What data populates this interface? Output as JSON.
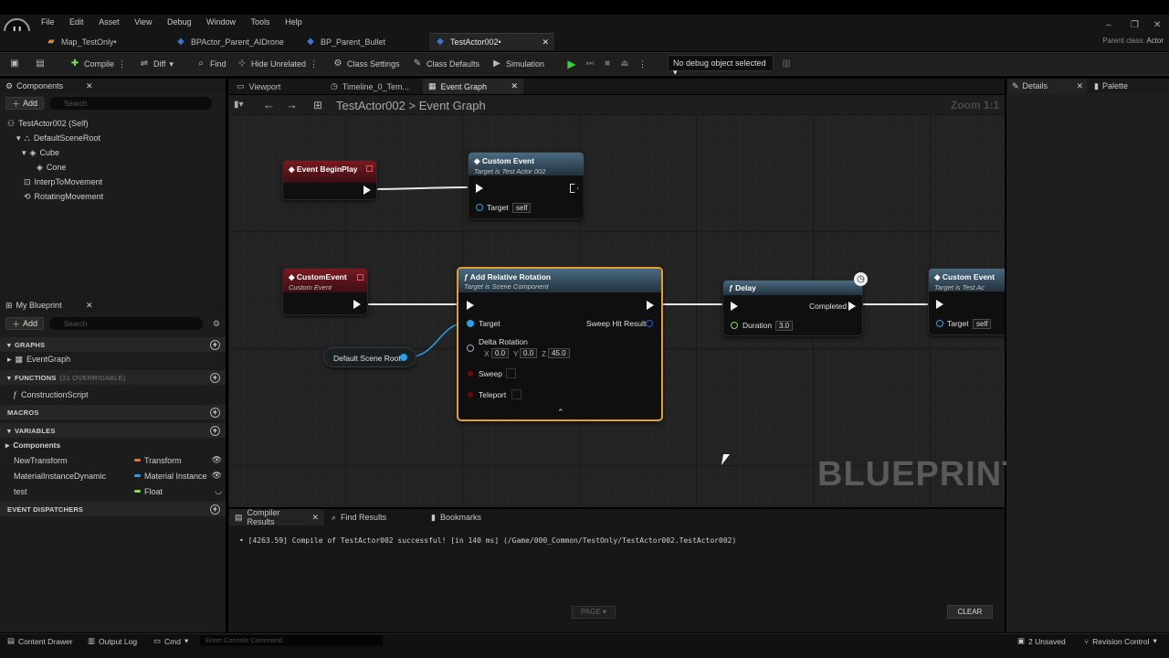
{
  "menu": [
    "File",
    "Edit",
    "Asset",
    "View",
    "Debug",
    "Window",
    "Tools",
    "Help"
  ],
  "logo_icon": "unreal-logo-icon",
  "doc_tabs": [
    {
      "label": "Map_TestOnly•",
      "icon": "map-icon"
    },
    {
      "label": "BPActor_Parent_AIDrone",
      "icon": "blueprint-icon"
    },
    {
      "label": "BP_Parent_Bullet",
      "icon": "blueprint-icon"
    },
    {
      "label": "TestActor002•",
      "icon": "blueprint-icon",
      "active": true
    }
  ],
  "parent_class": {
    "label": "Parent class:",
    "value": "Actor"
  },
  "toolbar": {
    "compile": "Compile",
    "diff": "Diff",
    "find": "Find",
    "hide_unrelated": "Hide Unrelated",
    "class_settings": "Class Settings",
    "class_defaults": "Class Defaults",
    "simulation": "Simulation",
    "debug_object": "No debug object selected"
  },
  "components": {
    "title": "Components",
    "add": "Add",
    "search_placeholder": "Search",
    "tree": [
      "TestActor002 (Self)",
      "DefaultSceneRoot",
      "Cube",
      "Cone",
      "InterpToMovement",
      "RotatingMovement"
    ]
  },
  "my_blueprint": {
    "title": "My Blueprint",
    "add": "Add",
    "search_placeholder": "Search",
    "graphs_label": "GRAPHS",
    "event_graph": "EventGraph",
    "functions_label": "FUNCTIONS",
    "functions_count": "(21 OVERRIDABLE)",
    "construction_script": "ConstructionScript",
    "macros_label": "MACROS",
    "variables_label": "VARIABLES",
    "components_group": "Components",
    "variables": [
      {
        "name": "NewTransform",
        "type": "Transform",
        "color": "#e8743a"
      },
      {
        "name": "MaterialInstanceDynamic",
        "type": "Material Instance",
        "color": "#27a0e8"
      },
      {
        "name": "test",
        "type": "Float",
        "color": "#7ee04a"
      }
    ],
    "dispatchers_label": "EVENT DISPATCHERS"
  },
  "graph_tabs": [
    "Viewport",
    "Timeline_0_Tem...",
    "Event Graph"
  ],
  "breadcrumb": {
    "root": "TestActor002",
    "sep": ">",
    "current": "Event Graph"
  },
  "zoom": "Zoom 1:1",
  "watermark": "BLUEPRINT",
  "nodes": {
    "begin_play": {
      "title": "Event BeginPlay"
    },
    "custom_event_call_1": {
      "title": "Custom Event",
      "sub": "Target is Test Actor 002",
      "target": "Target",
      "self": "self"
    },
    "custom_event": {
      "title": "CustomEvent",
      "sub": "Custom Event"
    },
    "add_rel_rot": {
      "title": "Add Relative Rotation",
      "sub": "Target is Scene Component",
      "target": "Target",
      "sweep_hit": "Sweep Hit Result",
      "delta": "Delta Rotation",
      "x_label": "X",
      "x": "0.0",
      "y_label": "Y",
      "y": "0.0",
      "z_label": "Z",
      "z": "45.0",
      "sweep": "Sweep",
      "teleport": "Teleport"
    },
    "scene_root": {
      "title": "Default Scene Root"
    },
    "delay": {
      "title": "Delay",
      "completed": "Completed",
      "duration": "Duration",
      "duration_value": "3.0"
    },
    "custom_event_call_2": {
      "title": "Custom Event",
      "sub": "Target is Test Ac",
      "target": "Target",
      "self": "self"
    }
  },
  "right_tabs": [
    "Details",
    "Palette"
  ],
  "bottom_tabs": [
    "Compiler Results",
    "Find Results",
    "Bookmarks"
  ],
  "log_line": "[4263.59] Compile of TestActor002 successful! [in 140 ms] (/Game/000_Common/TestOnly/TestActor002.TestActor002)",
  "page_btn": "PAGE",
  "clear_btn": "CLEAR",
  "status": {
    "content_drawer": "Content Drawer",
    "output_log": "Output Log",
    "cmd": "Cmd",
    "console_placeholder": "Enter Console Command",
    "unsaved": "2 Unsaved",
    "revision": "Revision Control"
  }
}
